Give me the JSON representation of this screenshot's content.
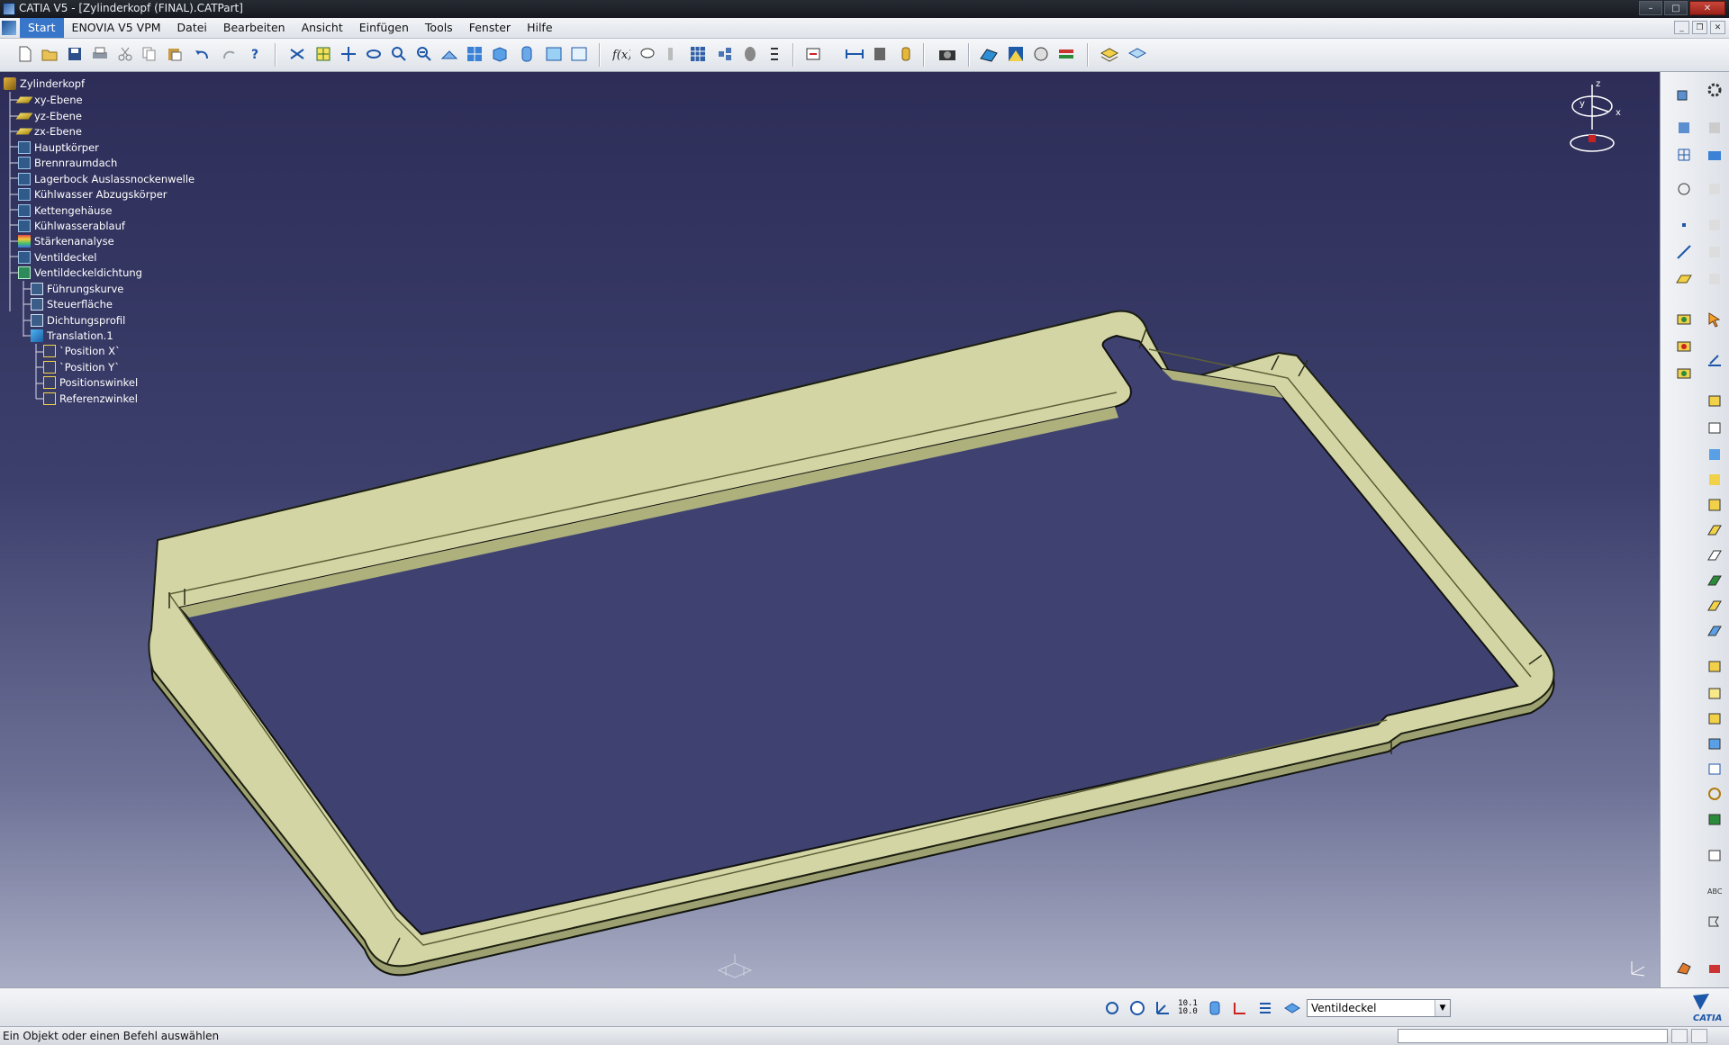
{
  "window": {
    "title": "CATIA V5 - [Zylinderkopf (FINAL).CATPart]"
  },
  "menu": {
    "items": [
      "Start",
      "ENOVIA V5 VPM",
      "Datei",
      "Bearbeiten",
      "Ansicht",
      "Einfügen",
      "Tools",
      "Fenster",
      "Hilfe"
    ]
  },
  "tree": {
    "root": "Zylinderkopf",
    "planes": [
      "xy-Ebene",
      "yz-Ebene",
      "zx-Ebene"
    ],
    "bodies": [
      "Hauptkörper",
      "Brennraumdach",
      "Lagerbock Auslassnockenwelle",
      "Kühlwasser Abzugskörper",
      "Kettengehäuse",
      "Kühlwasserablauf"
    ],
    "analysis": "Stärkenanalyse",
    "body_valve": "Ventildeckel",
    "seal": "Ventildeckeldichtung",
    "seal_children": [
      "Führungskurve",
      "Steuerfläche",
      "Dichtungsprofil"
    ],
    "translation": "Translation.1",
    "params": [
      "`Position X`",
      "`Position Y`",
      "Positionswinkel",
      "Referenzwinkel"
    ]
  },
  "compass": {
    "x_label": "x",
    "y_label": "y",
    "z_label": "z"
  },
  "bottom": {
    "layer_value": "Ventildeckel",
    "scale_top": "10.1",
    "scale_bottom": "10.0"
  },
  "status": {
    "text": "Ein Objekt oder einen Befehl auswählen"
  },
  "brand": {
    "catia": "CATIA"
  },
  "colors": {
    "viewport_top": "#2d2d58",
    "viewport_bottom": "#a9adc4",
    "part": "#d3d6a4",
    "menu_active": "#3876c9"
  }
}
